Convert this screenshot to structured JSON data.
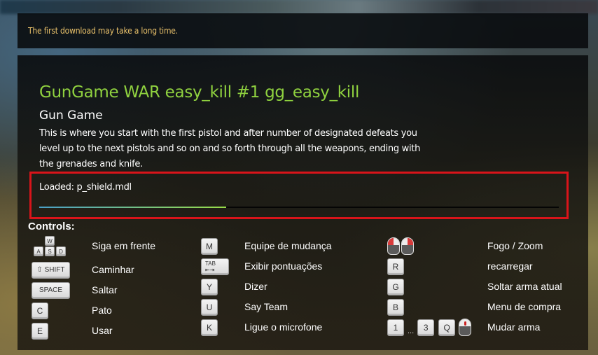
{
  "notice": {
    "text": "The first download may take a long time."
  },
  "server": {
    "title": "GunGame WAR easy_kill #1 gg_easy_kill",
    "mode": "Gun Game",
    "description": "This is where you start with the first pistol and after number of designated defeats you level up to the next pistols and so on and so forth through all the weapons, ending with the grenades and knife."
  },
  "loading": {
    "status_text": "Loaded: p_shield.mdl",
    "progress_percent": 36,
    "colors": {
      "border": "#d9141a",
      "fill_start": "#4aa0c8",
      "fill_end": "#98dc48"
    }
  },
  "controls": {
    "label": "Controls:",
    "columns": [
      [
        {
          "keys": [
            "W",
            "A",
            "S",
            "D"
          ],
          "action": "Siga em frente"
        },
        {
          "keys": [
            "⇧ SHIFT"
          ],
          "action": "Caminhar"
        },
        {
          "keys": [
            "SPACE"
          ],
          "action": "Saltar"
        },
        {
          "keys": [
            "C"
          ],
          "action": "Pato"
        },
        {
          "keys": [
            "E"
          ],
          "action": "Usar"
        }
      ],
      [
        {
          "keys": [
            "M"
          ],
          "action": "Equipe de mudança"
        },
        {
          "keys": [
            "TAB ⇤⇥"
          ],
          "action": "Exibir pontuações"
        },
        {
          "keys": [
            "Y"
          ],
          "action": "Dizer"
        },
        {
          "keys": [
            "U"
          ],
          "action": "Say Team"
        },
        {
          "keys": [
            "K"
          ],
          "action": "Ligue o microfone"
        }
      ],
      [
        {
          "keys": [
            "mouse-left",
            "mouse-right"
          ],
          "action": "Fogo / Zoom"
        },
        {
          "keys": [
            "R"
          ],
          "action": "recarregar"
        },
        {
          "keys": [
            "G"
          ],
          "action": "Soltar arma atual"
        },
        {
          "keys": [
            "B"
          ],
          "action": "Menu de compra"
        },
        {
          "keys": [
            "1",
            "...",
            "3",
            "Q",
            "mouse-wheel"
          ],
          "action": "Mudar arma"
        }
      ]
    ]
  },
  "colors": {
    "title": "#8fd13f",
    "notice": "#e8c06a"
  }
}
